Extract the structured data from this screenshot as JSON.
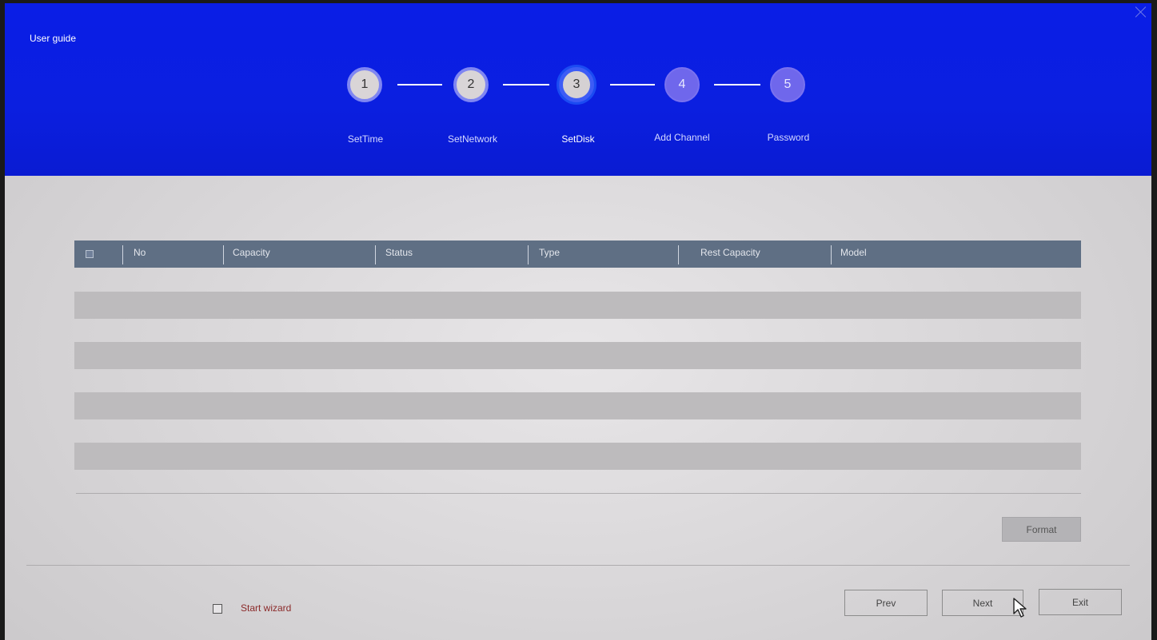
{
  "window": {
    "title": "User guide",
    "close_icon": "close-icon"
  },
  "steps": [
    {
      "number": "1",
      "label": "SetTime",
      "state": "done"
    },
    {
      "number": "2",
      "label": "SetNetwork",
      "state": "done"
    },
    {
      "number": "3",
      "label": "SetDisk",
      "state": "active"
    },
    {
      "number": "4",
      "label": "Add Channel",
      "state": "todo"
    },
    {
      "number": "5",
      "label": "Password",
      "state": "todo"
    }
  ],
  "disk_table": {
    "columns": [
      "No",
      "Capacity",
      "Status",
      "Type",
      "Rest Capacity",
      "Model"
    ],
    "select_all_checked": false,
    "rows": []
  },
  "buttons": {
    "format": "Format",
    "prev": "Prev",
    "next": "Next",
    "exit": "Exit"
  },
  "wizard": {
    "label": "Start wizard",
    "checked": false
  },
  "colors": {
    "header_blue": "#0a1ee6",
    "table_header": "#5f6f84",
    "wizard_label": "#8b2a2a"
  }
}
